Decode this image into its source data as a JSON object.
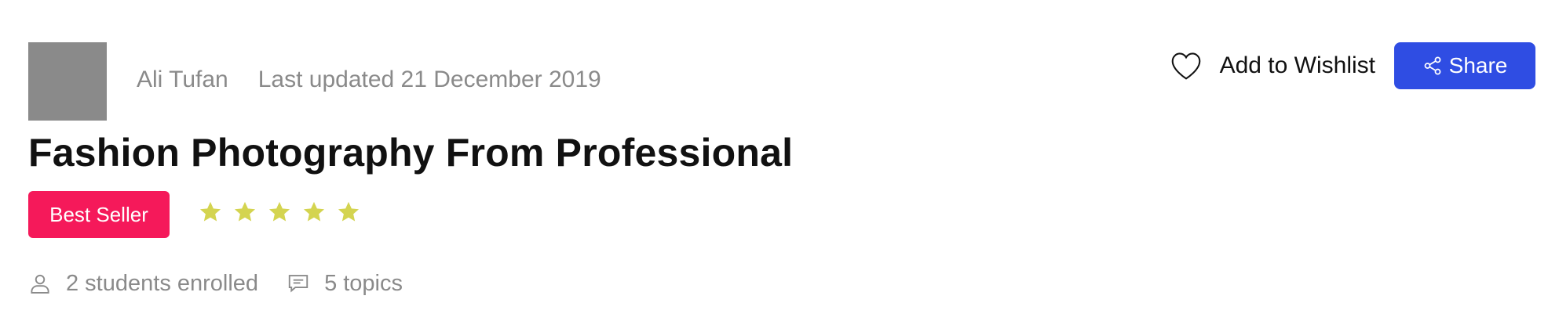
{
  "course": {
    "author": "Ali Tufan",
    "last_updated": "Last updated 21 December 2019",
    "title": "Fashion Photography From Professional",
    "badge": "Best Seller",
    "rating_stars": 5,
    "students": "2 students enrolled",
    "topics": "5 topics"
  },
  "actions": {
    "wishlist_label": "Add to Wishlist",
    "share_label": "Share"
  },
  "icons": {
    "wishlist": "heart-icon",
    "share": "share-icon",
    "students": "user-icon",
    "topics": "comment-icon",
    "rating": "star-icon"
  },
  "colors": {
    "badge": "#f5195a",
    "star": "#d4d450",
    "share_button": "#2f4de3",
    "muted_text": "#8a8a8a",
    "avatar_placeholder": "#8a8a8a"
  }
}
